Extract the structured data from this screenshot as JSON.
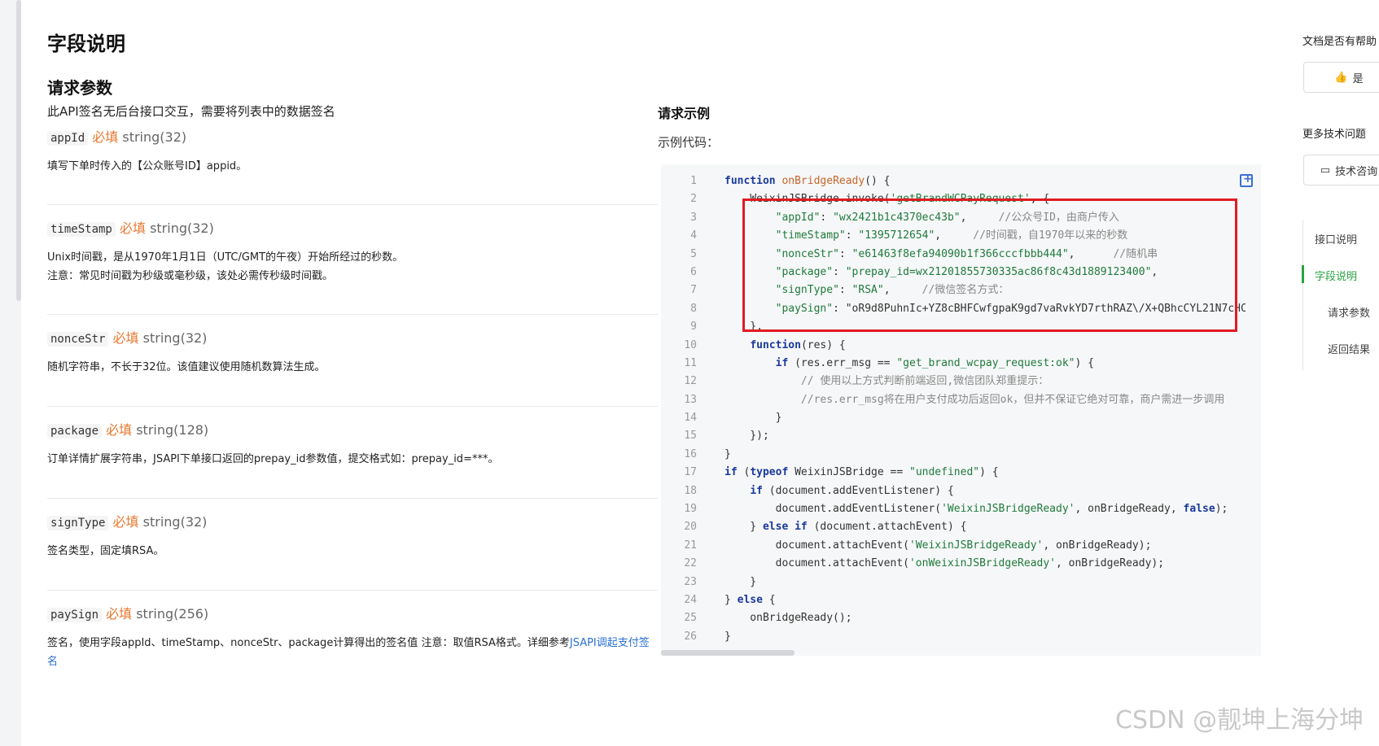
{
  "page_title": "字段说明",
  "section_title": "请求参数",
  "intro": "此API签名无后台接口交互，需要将列表中的数据签名",
  "params": [
    {
      "name": "appId",
      "required": "必填",
      "type": "string(32)",
      "desc": [
        "填写下单时传入的【公众账号ID】appid。"
      ]
    },
    {
      "name": "timeStamp",
      "required": "必填",
      "type": "string(32)",
      "desc": [
        "Unix时间戳，是从1970年1月1日（UTC/GMT的午夜）开始所经过的秒数。",
        "注意：常见时间戳为秒级或毫秒级，该处必需传秒级时间戳。"
      ]
    },
    {
      "name": "nonceStr",
      "required": "必填",
      "type": "string(32)",
      "desc": [
        "随机字符串，不长于32位。该值建议使用随机数算法生成。"
      ]
    },
    {
      "name": "package",
      "required": "必填",
      "type": "string(128)",
      "desc": [
        "订单详情扩展字符串，JSAPI下单接口返回的prepay_id参数值，提交格式如：prepay_id=***。"
      ]
    },
    {
      "name": "signType",
      "required": "必填",
      "type": "string(32)",
      "desc": [
        "签名类型，固定填RSA。"
      ]
    },
    {
      "name": "paySign",
      "required": "必填",
      "type": "string(256)",
      "desc_text": "签名，使用字段appId、timeStamp、nonceStr、package计算得出的签名值 注意：取值RSA格式。详细参考",
      "desc_link": "JSAPI调起支付签名"
    }
  ],
  "example_title": "请求示例",
  "example_label": "示例代码：",
  "code_lines": [
    {
      "n": "1",
      "t": "function onBridgeReady() {"
    },
    {
      "n": "2",
      "t": "    WeixinJSBridge.invoke('getBrandWCPayRequest', {"
    },
    {
      "n": "3",
      "t": "        \"appId\": \"wx2421b1c4370ec43b\",     //公众号ID，由商户传入"
    },
    {
      "n": "4",
      "t": "        \"timeStamp\": \"1395712654\",     //时间戳，自1970年以来的秒数"
    },
    {
      "n": "5",
      "t": "        \"nonceStr\": \"e61463f8efa94090b1f366cccfbbb444\",      //随机串"
    },
    {
      "n": "6",
      "t": "        \"package\": \"prepay_id=wx21201855730335ac86f8c43d1889123400\","
    },
    {
      "n": "7",
      "t": "        \"signType\": \"RSA\",     //微信签名方式："
    },
    {
      "n": "8",
      "t": "        \"paySign\": \"oR9d8PuhnIc+YZ8cBHFCwfgpaK9gd7vaRvkYD7rthRAZ\\/X+QBhcCYL21N7cHC"
    },
    {
      "n": "9",
      "t": "    },"
    },
    {
      "n": "10",
      "t": "    function(res) {"
    },
    {
      "n": "11",
      "t": "        if (res.err_msg == \"get_brand_wcpay_request:ok\") {"
    },
    {
      "n": "12",
      "t": "            // 使用以上方式判断前端返回,微信团队郑重提示："
    },
    {
      "n": "13",
      "t": "            //res.err_msg将在用户支付成功后返回ok，但并不保证它绝对可靠，商户需进一步调用"
    },
    {
      "n": "14",
      "t": "        }"
    },
    {
      "n": "15",
      "t": "    });"
    },
    {
      "n": "16",
      "t": "}"
    },
    {
      "n": "17",
      "t": "if (typeof WeixinJSBridge == \"undefined\") {"
    },
    {
      "n": "18",
      "t": "    if (document.addEventListener) {"
    },
    {
      "n": "19",
      "t": "        document.addEventListener('WeixinJSBridgeReady', onBridgeReady, false);"
    },
    {
      "n": "20",
      "t": "    } else if (document.attachEvent) {"
    },
    {
      "n": "21",
      "t": "        document.attachEvent('WeixinJSBridgeReady', onBridgeReady);"
    },
    {
      "n": "22",
      "t": "        document.attachEvent('onWeixinJSBridgeReady', onBridgeReady);"
    },
    {
      "n": "23",
      "t": "    }"
    },
    {
      "n": "24",
      "t": "} else {"
    },
    {
      "n": "25",
      "t": "    onBridgeReady();"
    },
    {
      "n": "26",
      "t": "}"
    }
  ],
  "right_panel": {
    "helpful_q": "文档是否有帮助",
    "yes_label": "是",
    "more_q": "更多技术问题",
    "consult_label": "技术咨询",
    "toc": [
      "接口说明",
      "字段说明",
      "请求参数",
      "返回结果"
    ]
  },
  "watermark": "CSDN @靓坤上海分坤"
}
